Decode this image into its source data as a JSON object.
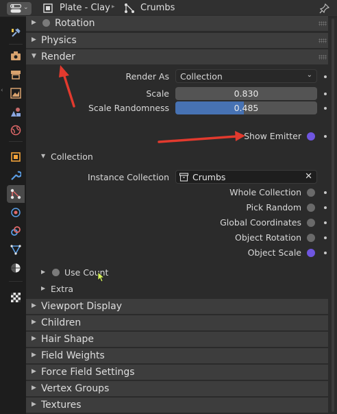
{
  "header": {
    "object_name": "Plate - Clay",
    "particle_system_name": "Crumbs"
  },
  "tabs": [
    {
      "name": "tool-tab-icon",
      "color": "#8fb0e0"
    },
    {
      "name": "render-tab-icon",
      "color": "#d8a26e"
    },
    {
      "name": "output-tab-icon",
      "color": "#d8a26e"
    },
    {
      "name": "view-layer-tab-icon",
      "color": "#d8a26e"
    },
    {
      "name": "scene-tab-icon",
      "color": "#c66a6a"
    },
    {
      "name": "world-tab-icon",
      "color": "#e36a6a"
    },
    {
      "name": "object-tab-icon",
      "color": "#f3a33a"
    },
    {
      "name": "modifiers-tab-icon",
      "color": "#5b9ee6"
    },
    {
      "name": "particles-tab-icon",
      "color": "#5b9ee6"
    },
    {
      "name": "physics-tab-icon",
      "color": "#5b9ee6"
    },
    {
      "name": "constraints-tab-icon",
      "color": "#5b9ee6"
    },
    {
      "name": "data-tab-icon",
      "color": "#67c46a"
    },
    {
      "name": "material-tab-icon",
      "color": "#e0714a"
    },
    {
      "name": "texture-tab-icon",
      "color": "#aaaaaa"
    }
  ],
  "panels": {
    "rotation": "Rotation",
    "physics": "Physics",
    "render": "Render",
    "viewport_display": "Viewport Display",
    "children": "Children",
    "hair_shape": "Hair Shape",
    "field_weights": "Field Weights",
    "force_field_settings": "Force Field Settings",
    "vertex_groups": "Vertex Groups",
    "textures": "Textures"
  },
  "render": {
    "render_as_label": "Render As",
    "render_as_value": "Collection",
    "scale_label": "Scale",
    "scale_value": "0.830",
    "scale_randomness_label": "Scale Randomness",
    "scale_randomness_value": "0.485",
    "scale_randomness_fraction": 0.485,
    "show_emitter_label": "Show Emitter",
    "show_emitter_checked": true,
    "collection_subpanel": "Collection",
    "instance_collection_label": "Instance Collection",
    "instance_collection_value": "Crumbs",
    "whole_collection_label": "Whole Collection",
    "whole_collection_checked": false,
    "pick_random_label": "Pick Random",
    "pick_random_checked": false,
    "global_coordinates_label": "Global Coordinates",
    "global_coordinates_checked": false,
    "object_rotation_label": "Object Rotation",
    "object_rotation_checked": false,
    "object_scale_label": "Object Scale",
    "object_scale_checked": true,
    "use_count_label": "Use Count",
    "use_count_checked": false,
    "extra_subpanel": "Extra"
  },
  "colors": {
    "accent": "#4772b3",
    "checkbox_on": "#6f56e0",
    "annotation_arrow": "#e23a2e"
  }
}
